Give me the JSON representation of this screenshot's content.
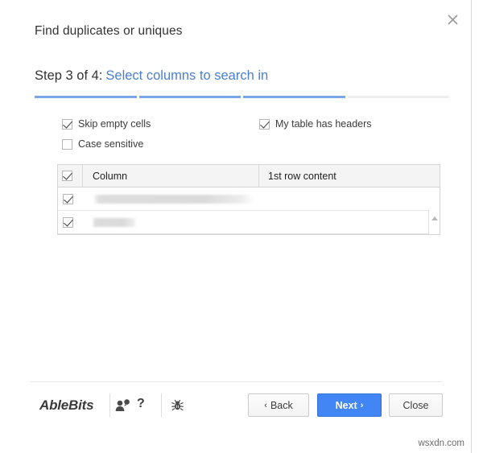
{
  "dialog": {
    "title": "Find duplicates or uniques",
    "close_icon": "close-icon"
  },
  "step": {
    "label": "Step 3 of 4:",
    "link": "Select columns to search in",
    "current": 3,
    "total": 4,
    "segments": [
      "done",
      "done",
      "done",
      "todo"
    ],
    "accent_done": "#7aa7e8",
    "accent_todo": "#eeeeee"
  },
  "options": [
    {
      "label": "Skip empty cells",
      "checked": true
    },
    {
      "label": "My table has headers",
      "checked": true
    },
    {
      "label": "Case sensitive",
      "checked": false
    }
  ],
  "table": {
    "select_all_checked": true,
    "columns": [
      "Column",
      "1st row content"
    ],
    "rows": [
      {
        "checked": true,
        "column": "",
        "first_row_content": "",
        "redacted": true,
        "redact_width": 200
      },
      {
        "checked": true,
        "column": "",
        "first_row_content": "",
        "redacted": true,
        "redact_width": 55
      }
    ],
    "scrollbar": {
      "up_icon": "scroll-up-arrow-icon",
      "down_icon": "scroll-down-arrow-icon"
    }
  },
  "footer": {
    "brand": "AbleBits",
    "feedback_icon": "feedback-person-icon",
    "help_label": "?",
    "bug_icon": "bug-icon",
    "buttons": {
      "back": {
        "label": "Back",
        "chevron": "‹"
      },
      "next": {
        "label": "Next",
        "chevron": "›",
        "primary_color": "#4285f4"
      },
      "close": {
        "label": "Close"
      }
    }
  },
  "watermark": "wsxdn.com"
}
